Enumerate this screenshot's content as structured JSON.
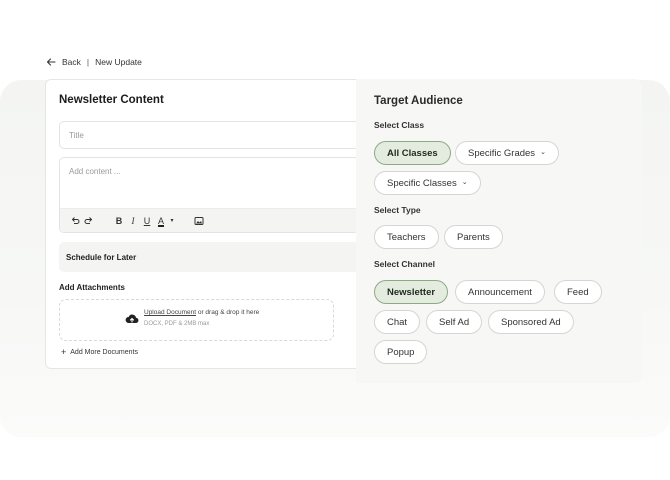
{
  "breadcrumb": {
    "back": "Back",
    "separator": "|",
    "current": "New Update"
  },
  "newsletter": {
    "title": "Newsletter Content",
    "title_placeholder": "Title",
    "content_placeholder": "Add content ...",
    "toolbar": {
      "bold": "B",
      "italic": "I",
      "underline": "U",
      "font_color": "A",
      "caret": "▾"
    },
    "schedule_label": "Schedule for Later",
    "attachments_label": "Add Attachments",
    "upload_link": "Upload Document",
    "upload_rest": " or drag & drop it here",
    "upload_hint": "DOCX, PDF & 2MB max",
    "add_more_icon": "+",
    "add_more": "Add More Documents"
  },
  "audience": {
    "title": "Target Audience",
    "class_label": "Select Class",
    "classes": {
      "all": "All Classes",
      "grades": "Specific Grades",
      "specific": "Specific Classes"
    },
    "chevron": "⌄",
    "type_label": "Select Type",
    "types": {
      "teachers": "Teachers",
      "parents": "Parents"
    },
    "channel_label": "Select Channel",
    "channels": {
      "newsletter": "Newsletter",
      "announcement": "Announcement",
      "feed": "Feed",
      "chat": "Chat",
      "selfad": "Self Ad",
      "sponsored": "Sponsored Ad",
      "popup": "Popup"
    }
  },
  "colors": {
    "accent_fill": "#e3ecdf",
    "accent_border": "#8fa888"
  }
}
